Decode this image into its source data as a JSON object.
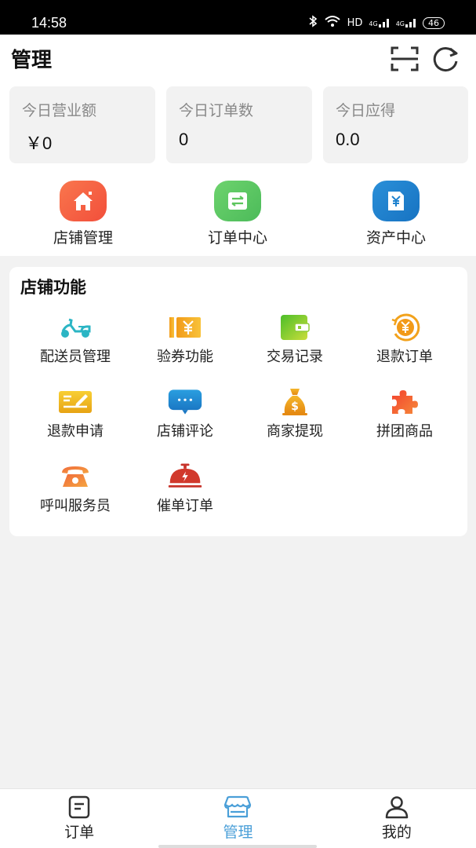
{
  "status_bar": {
    "time": "14:58",
    "icons": [
      "bluetooth-icon",
      "wifi-icon",
      "hd-icon",
      "signal-4g-icon",
      "signal-4g-icon"
    ],
    "hd_label": "HD",
    "net1": "4G",
    "net2": "4G",
    "battery": "46"
  },
  "header": {
    "title": "管理",
    "actions": [
      {
        "name": "scan",
        "icon": "scan-icon"
      },
      {
        "name": "refresh",
        "icon": "refresh-icon"
      }
    ]
  },
  "stats": [
    {
      "label": "今日营业额",
      "value": "￥0"
    },
    {
      "label": "今日订单数",
      "value": "0"
    },
    {
      "label": "今日应得",
      "value": "0.0"
    }
  ],
  "quick_nav": [
    {
      "label": "店铺管理",
      "icon": "store-house-icon",
      "color": "#f4623a"
    },
    {
      "label": "订单中心",
      "icon": "order-exchange-icon",
      "color": "#5ec65e"
    },
    {
      "label": "资产中心",
      "icon": "yuan-document-icon",
      "color": "#1e82cf"
    }
  ],
  "store_functions": {
    "title": "店铺功能",
    "items": [
      {
        "label": "配送员管理",
        "icon": "scooter-icon"
      },
      {
        "label": "验券功能",
        "icon": "coupon-icon"
      },
      {
        "label": "交易记录",
        "icon": "wallet-icon"
      },
      {
        "label": "退款订单",
        "icon": "refund-coin-icon"
      },
      {
        "label": "退款申请",
        "icon": "refund-form-icon"
      },
      {
        "label": "店铺评论",
        "icon": "comment-bubble-icon"
      },
      {
        "label": "商家提现",
        "icon": "money-bag-icon"
      },
      {
        "label": "拼团商品",
        "icon": "puzzle-icon"
      },
      {
        "label": "呼叫服务员",
        "icon": "telephone-icon"
      },
      {
        "label": "催单订单",
        "icon": "service-bell-icon"
      }
    ]
  },
  "tabbar": {
    "active_color": "#4a9fd8",
    "tabs": [
      {
        "label": "订单",
        "icon": "order-list-icon",
        "active": false
      },
      {
        "label": "管理",
        "icon": "shop-icon",
        "active": true
      },
      {
        "label": "我的",
        "icon": "user-icon",
        "active": false
      }
    ]
  }
}
